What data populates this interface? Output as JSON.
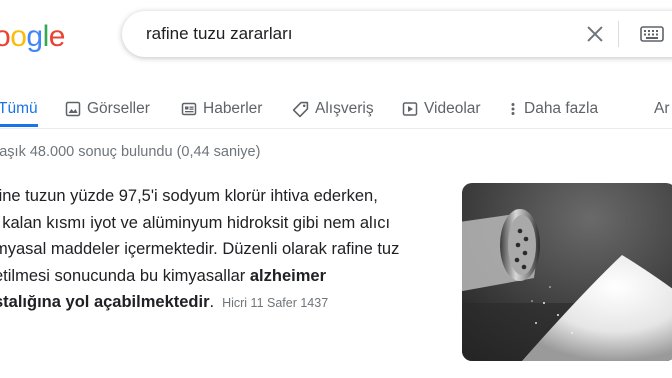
{
  "logo": {
    "letters": [
      "o",
      "o",
      "g",
      "l",
      "e"
    ]
  },
  "search": {
    "query": "rafine tuzu zararları"
  },
  "tabs": [
    {
      "label": "Tümü",
      "icon": "none"
    },
    {
      "label": "Görseller",
      "icon": "image-icon"
    },
    {
      "label": "Haberler",
      "icon": "news-icon"
    },
    {
      "label": "Alışveriş",
      "icon": "tag-icon"
    },
    {
      "label": "Videolar",
      "icon": "play-icon"
    },
    {
      "label": "Daha fazla",
      "icon": "more-vert-icon"
    },
    {
      "label": "Ar",
      "icon": "none"
    }
  ],
  "result_stats": "laşık 48.000 sonuç bulundu (0,44 saniye)",
  "snippet": {
    "line1": "fine tuzun yüzde 97,5'i sodyum klorür ihtiva ederken,",
    "line2": "i kalan kısmı iyot ve alüminyum hidroksit gibi nem alıcı",
    "line3": "myasal maddeler içermektedir. Düzenli olarak rafine tuz",
    "line4_plain": "etilmesi sonucunda bu kimyasallar ",
    "line4_bold": "alzheimer",
    "line5_bold": "stalığına yol açabilmektedir",
    "line5_plain": ".",
    "date": "Hicri 11 Safer 1437"
  },
  "colors": {
    "accent": "#1a73e8",
    "logo_blue": "#4285f4",
    "logo_red": "#ea4335",
    "logo_yellow": "#fbbc05",
    "logo_green": "#34a853"
  }
}
